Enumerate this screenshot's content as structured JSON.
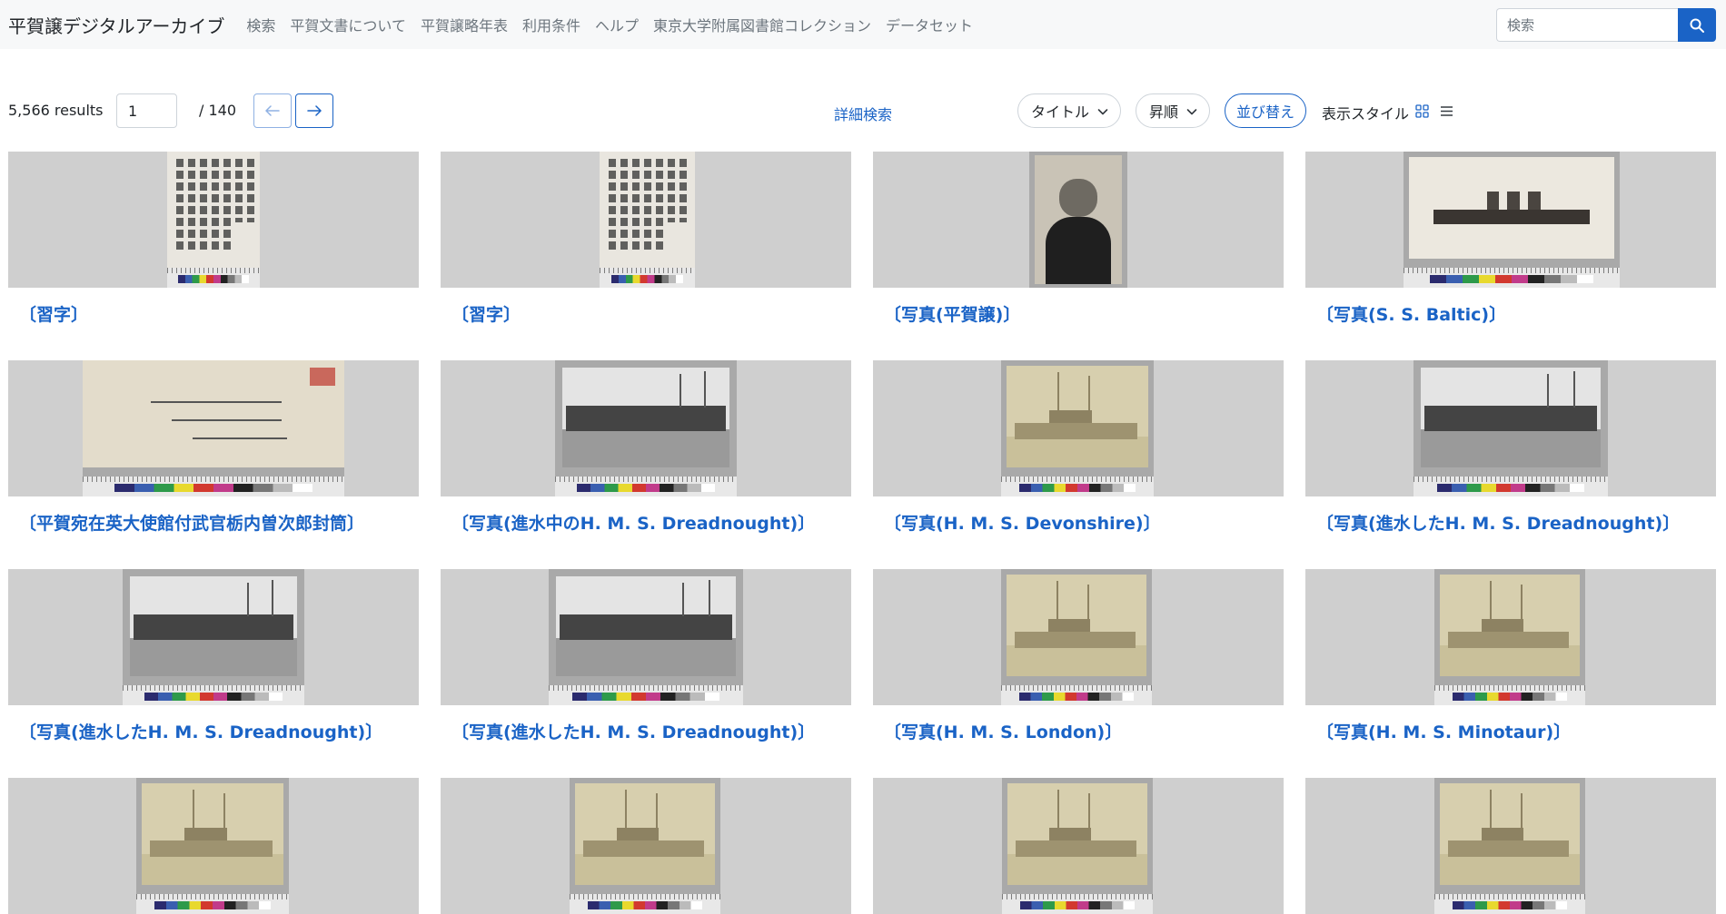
{
  "brand": "平賀譲デジタルアーカイブ",
  "nav": [
    "検索",
    "平賀文書について",
    "平賀譲略年表",
    "利用条件",
    "ヘルプ",
    "東京大学附属図書館コレクション",
    "データセット"
  ],
  "search": {
    "placeholder": "検索"
  },
  "toolbar": {
    "results": "5,566 results",
    "page": "1",
    "total_pages": "/ 140",
    "advanced_search": "詳細検索",
    "sort_field": "タイトル",
    "sort_order": "昇順",
    "sort_button": "並び替え",
    "display_style": "表示スタイル"
  },
  "items": [
    {
      "title": "〔習字〕",
      "kind": "calligraphy"
    },
    {
      "title": "〔習字〕",
      "kind": "calligraphy"
    },
    {
      "title": "〔写真(平賀譲)〕",
      "kind": "portrait"
    },
    {
      "title": "〔写真(S. S. Baltic)〕",
      "kind": "ship"
    },
    {
      "title": "〔平賀宛在英大使館付武官栃内曽次郎封筒〕",
      "kind": "envelope"
    },
    {
      "title": "〔写真(進水中のH. M. S. Dreadnought)〕",
      "kind": "launch"
    },
    {
      "title": "〔写真(H. M. S. Devonshire)〕",
      "kind": "sepia-ship"
    },
    {
      "title": "〔写真(進水したH. M. S. Dreadnought)〕",
      "kind": "launch"
    },
    {
      "title": "〔写真(進水したH. M. S. Dreadnought)〕",
      "kind": "launch"
    },
    {
      "title": "〔写真(進水したH. M. S. Dreadnought)〕",
      "kind": "launch"
    },
    {
      "title": "〔写真(H. M. S. London)〕",
      "kind": "sepia-ship"
    },
    {
      "title": "〔写真(H. M. S. Minotaur)〕",
      "kind": "sepia-ship"
    },
    {
      "title": "",
      "kind": "sepia-ship"
    },
    {
      "title": "",
      "kind": "sepia-ship"
    },
    {
      "title": "",
      "kind": "sepia-ship"
    },
    {
      "title": "",
      "kind": "sepia-ship"
    }
  ]
}
